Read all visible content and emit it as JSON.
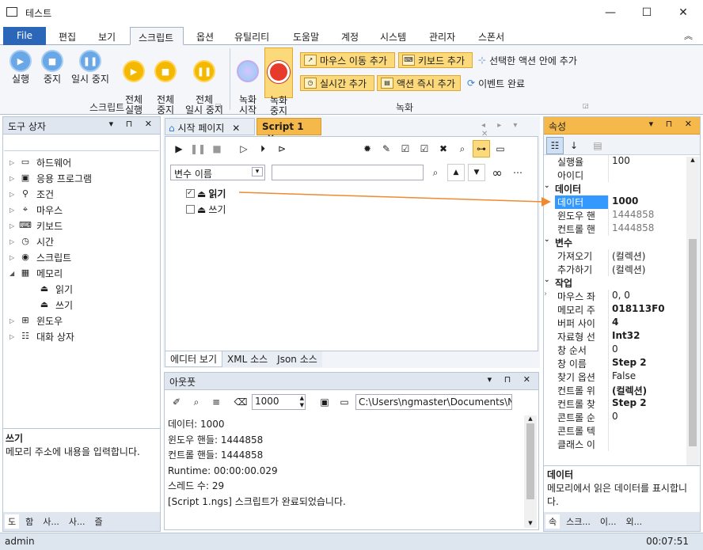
{
  "app": {
    "title": "테스트",
    "min_glyph": "—",
    "max_glyph": "☐",
    "close_glyph": "✕"
  },
  "menu": {
    "file": "File",
    "tabs": [
      "편집",
      "보기",
      "스크립트",
      "옵션",
      "유틸리티",
      "도움말",
      "계정",
      "시스템",
      "관리자",
      "스폰서"
    ],
    "collapse_glyph": "︽"
  },
  "ribbon": {
    "script_group": {
      "label": "스크립트",
      "run": "실행",
      "stop": "중지",
      "pause": "일시 중지",
      "run_all": "전체\n실행",
      "stop_all": "전체\n중지",
      "pause_all": "전체\n일시 중지"
    },
    "record_group": {
      "label": "녹화",
      "record_start": "녹화\n시작",
      "record_stop": "녹화\n중지",
      "mouse_move": "마우스 이동 추가",
      "keyboard": "키보드 추가",
      "inside_action": "선택한 액션 안에 추가",
      "realtime": "실시간 추가",
      "action_now": "액션 즉시 추가",
      "event_done": "이벤트 완료"
    }
  },
  "toolbox": {
    "title": "도구 상자",
    "items": [
      {
        "label": "하드웨어",
        "icon": "computer-icon",
        "glyph": "▭"
      },
      {
        "label": "응용 프로그램",
        "icon": "app-window-icon",
        "glyph": "▣"
      },
      {
        "label": "조건",
        "icon": "condition-icon",
        "glyph": "⚲"
      },
      {
        "label": "마우스",
        "icon": "mouse-icon",
        "glyph": "⌖"
      },
      {
        "label": "키보드",
        "icon": "keyboard-icon",
        "glyph": "⌨"
      },
      {
        "label": "시간",
        "icon": "clock-icon",
        "glyph": "◷"
      },
      {
        "label": "스크립트",
        "icon": "script-icon",
        "glyph": "◉"
      },
      {
        "label": "메모리",
        "icon": "memory-icon",
        "glyph": "▦"
      }
    ],
    "children": [
      {
        "label": "읽기",
        "glyph": "⏏"
      },
      {
        "label": "쓰기",
        "glyph": "⏏"
      }
    ],
    "items_after": [
      {
        "label": "윈도우",
        "icon": "windows-icon",
        "glyph": "⊞"
      },
      {
        "label": "대화 상자",
        "icon": "dialog-icon",
        "glyph": "☷"
      }
    ],
    "desc_title": "쓰기",
    "desc_text": "메모리 주소에 내용을 입력합니다.",
    "bottom_tabs": [
      "도",
      "함",
      "사...",
      "사...",
      "즐"
    ]
  },
  "editor": {
    "tabs": [
      {
        "label": "시작 페이지",
        "close": "✕"
      },
      {
        "label": "Script 1",
        "close": "✕"
      }
    ],
    "var_placeholder": "변수 이름",
    "nodes": [
      {
        "label": "읽기",
        "checked": true
      },
      {
        "label": "쓰기",
        "checked": false
      }
    ],
    "bottom_tabs": [
      "에디터 보기",
      "XML 소스",
      "Json 소스"
    ]
  },
  "output": {
    "title": "아웃풋",
    "count": "1000",
    "path": "C:\\Users\\ngmaster\\Documents\\NGM",
    "lines": [
      "데이터: 1000",
      "윈도우 핸들: 1444858",
      "컨트롤 핸들: 1444858",
      "Runtime: 00:00:00.029",
      "스레드 수: 29",
      "[Script 1.ngs] 스크립트가 완료되었습니다."
    ]
  },
  "properties": {
    "title": "속성",
    "rows_top": [
      {
        "name": "실행율",
        "value": "100"
      },
      {
        "name": "아이디",
        "value": ""
      }
    ],
    "cat_data": "데이터",
    "data_rows": [
      {
        "name": "데이터",
        "value": "1000",
        "selected": true
      },
      {
        "name": "윈도우 핸",
        "value": "1444858",
        "gray": true
      },
      {
        "name": "컨트롤 핸",
        "value": "1444858",
        "gray": true
      }
    ],
    "cat_var": "변수",
    "var_rows": [
      {
        "name": "가져오기",
        "value": "(컬렉션)"
      },
      {
        "name": "추가하기",
        "value": "(컬렉션)"
      }
    ],
    "cat_work": "작업",
    "work_rows": [
      {
        "name": "마우스 좌",
        "value": "0, 0",
        "expand": true
      },
      {
        "name": "메모리 주",
        "value": "018113F0",
        "bold": true
      },
      {
        "name": "버퍼 사이",
        "value": "4",
        "bold": true
      },
      {
        "name": "자료형 선",
        "value": "Int32",
        "bold": true
      },
      {
        "name": "창 순서",
        "value": "0"
      },
      {
        "name": "창 이름",
        "value": "Step 2",
        "bold": true
      },
      {
        "name": "찾기 옵션",
        "value": "False"
      },
      {
        "name": "컨트롤 위",
        "value": "(컬렉션)",
        "bold": true
      },
      {
        "name": "컨트롤 찾",
        "value": "Step 2",
        "bold": true
      },
      {
        "name": "콘트롤 순",
        "value": "0"
      },
      {
        "name": "콘트롤 텍",
        "value": ""
      },
      {
        "name": "클래스 이",
        "value": ""
      }
    ],
    "desc_title": "데이터",
    "desc_text": "메모리에서 읽은 데이터를 표시합니다.",
    "bottom_tabs": [
      "속",
      "스크...",
      "이...",
      "외..."
    ]
  },
  "status": {
    "user": "admin",
    "time": "00:07:51"
  }
}
